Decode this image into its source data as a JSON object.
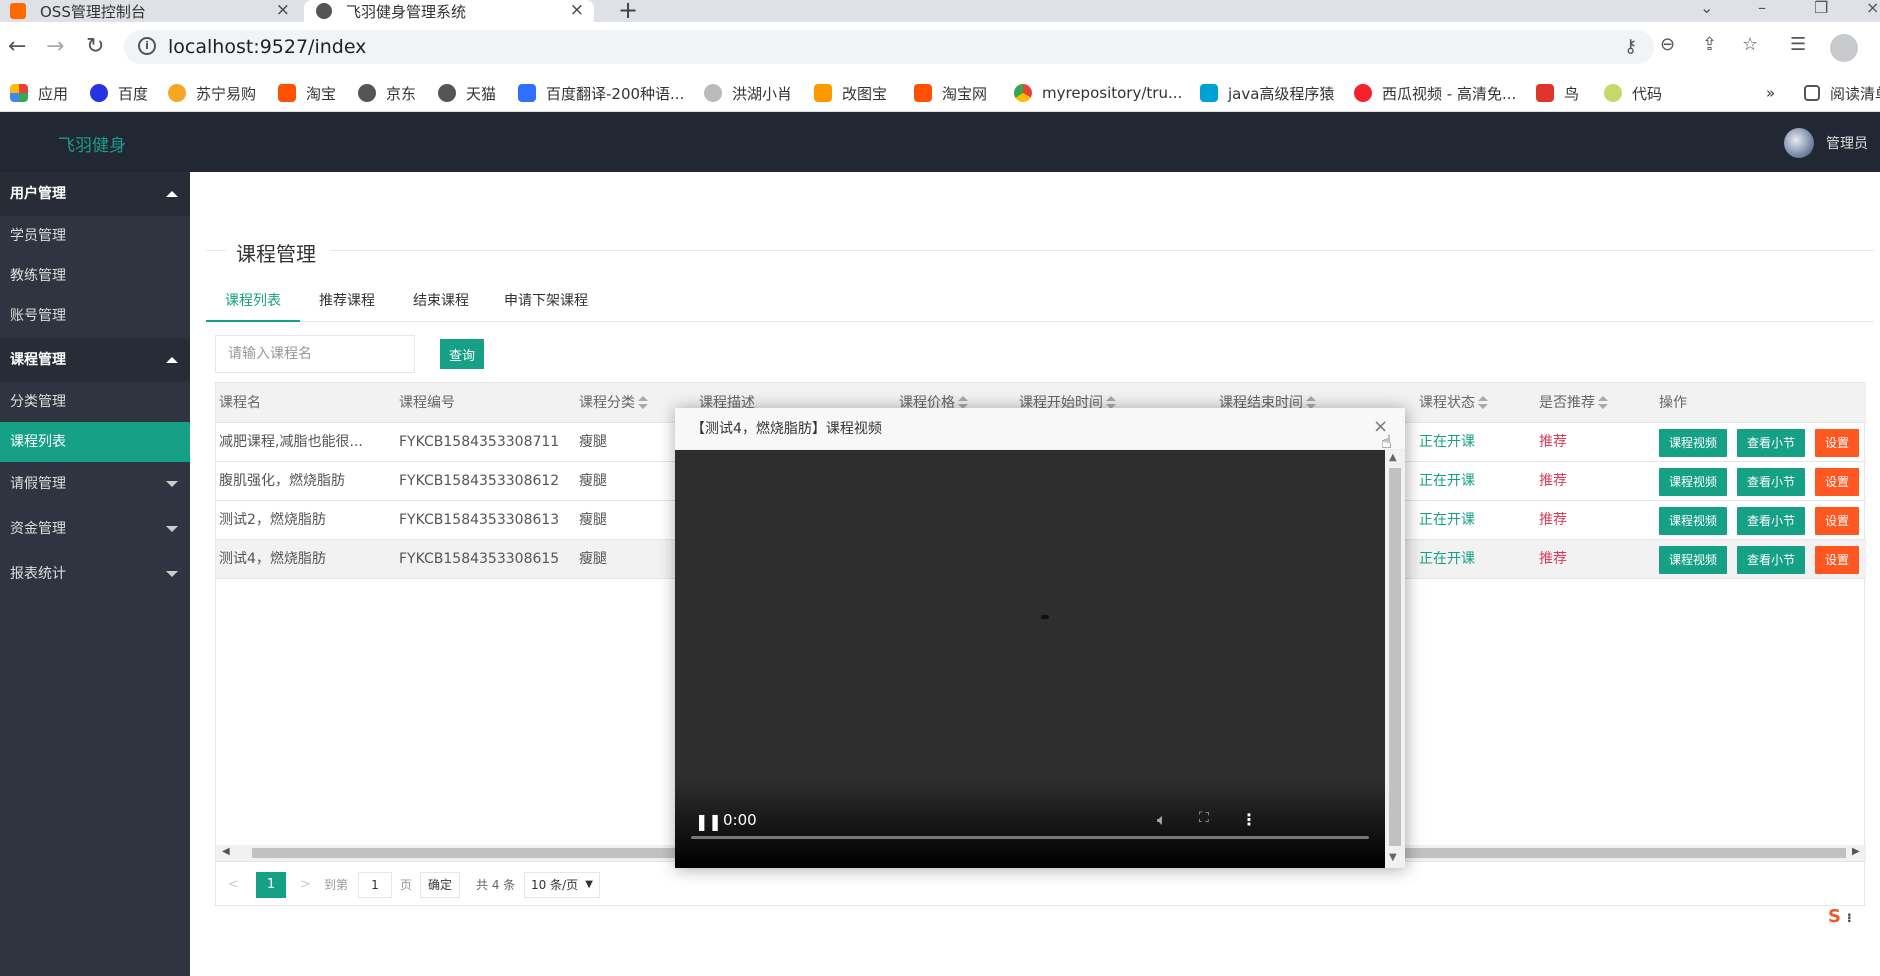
{
  "browser": {
    "tabs": [
      {
        "title": "OSS管理控制台",
        "icon_color": "#ff6a00"
      },
      {
        "title": "飞羽健身管理系统",
        "icon_color": "#555555"
      }
    ],
    "url": "localhost:9527/index",
    "bookmarks": [
      {
        "label": "应用",
        "icon": "apps-grid-icon",
        "color": "#e94235"
      },
      {
        "label": "百度",
        "icon": "baidu-paw-icon",
        "color": "#2932e1"
      },
      {
        "label": "苏宁易购",
        "icon": "suning-icon",
        "color": "#f5a623"
      },
      {
        "label": "淘宝",
        "icon": "taobao-icon",
        "color": "#ff5000"
      },
      {
        "label": "京东",
        "icon": "globe-icon",
        "color": "#555555"
      },
      {
        "label": "天猫",
        "icon": "globe-icon",
        "color": "#555555"
      },
      {
        "label": "百度翻译-200种语...",
        "icon": "baidu-translate-icon",
        "color": "#2f6fff"
      },
      {
        "label": "洪湖小肖",
        "icon": "bird-icon",
        "color": "#888888"
      },
      {
        "label": "改图宝",
        "icon": "gaitubao-icon",
        "color": "#ff9900"
      },
      {
        "label": "淘宝网",
        "icon": "taobao-icon",
        "color": "#ff5000"
      },
      {
        "label": "myrepository/tru...",
        "icon": "chrome-icon",
        "color": "#4285f4"
      },
      {
        "label": "java高级程序猿",
        "icon": "bilibili-icon",
        "color": "#00a1d6"
      },
      {
        "label": "西瓜视频 - 高清免...",
        "icon": "xigua-icon",
        "color": "#f5222d"
      },
      {
        "label": "鸟",
        "icon": "bird-red-icon",
        "color": "#e0332a"
      },
      {
        "label": "代码",
        "icon": "leaf-icon",
        "color": "#c8d86a"
      }
    ],
    "more": "»",
    "reading_list": "阅读清单"
  },
  "app": {
    "logo": "飞羽健身",
    "user": "管理员"
  },
  "sidebar": {
    "groups": [
      {
        "label": "用户管理",
        "expanded": true,
        "items": [
          "学员管理",
          "教练管理",
          "账号管理"
        ]
      },
      {
        "label": "课程管理",
        "expanded": true,
        "items": [
          "分类管理",
          "课程列表"
        ]
      },
      {
        "label": "请假管理",
        "expanded": false,
        "items": []
      },
      {
        "label": "资金管理",
        "expanded": false,
        "items": []
      },
      {
        "label": "报表统计",
        "expanded": false,
        "items": []
      }
    ],
    "active_item": "课程列表"
  },
  "page": {
    "title": "课程管理",
    "tabs": [
      "课程列表",
      "推荐课程",
      "结束课程",
      "申请下架课程"
    ],
    "search_placeholder": "请输入课程名",
    "search_button": "查询"
  },
  "table": {
    "headers": [
      "课程名",
      "课程编号",
      "课程分类",
      "课程描述",
      "课程价格",
      "课程开始时间",
      "课程结束时间",
      "课程状态",
      "是否推荐",
      "操作"
    ],
    "rows": [
      {
        "name": "减肥课程,减脂也能很...",
        "code": "FYKCB1584353308711",
        "category": "瘦腿",
        "status": "正在开课",
        "recommend": "推荐"
      },
      {
        "name": "腹肌强化，燃烧脂肪",
        "code": "FYKCB1584353308612",
        "category": "瘦腿",
        "status": "正在开课",
        "recommend": "推荐"
      },
      {
        "name": "测试2，燃烧脂肪",
        "code": "FYKCB1584353308613",
        "category": "瘦腿",
        "status": "正在开课",
        "recommend": "推荐"
      },
      {
        "name": "测试4，燃烧脂肪",
        "code": "FYKCB1584353308615",
        "category": "瘦腿",
        "status": "正在开课",
        "recommend": "推荐"
      }
    ],
    "actions": [
      "课程视频",
      "查看小节",
      "设置"
    ]
  },
  "pager": {
    "prev": "<",
    "current": "1",
    "next": ">",
    "goto_label": "到第",
    "goto_value": "1",
    "page_unit": "页",
    "confirm": "确定",
    "total": "共 4 条",
    "per_page": "10 条/页"
  },
  "modal": {
    "title": "【测试4，燃烧脂肪】课程视频",
    "close": "×",
    "video_time": "0:00"
  },
  "colors": {
    "accent": "#16a085",
    "danger": "#ff5722",
    "sidebar": "#2f3540",
    "topbar": "#222833"
  }
}
